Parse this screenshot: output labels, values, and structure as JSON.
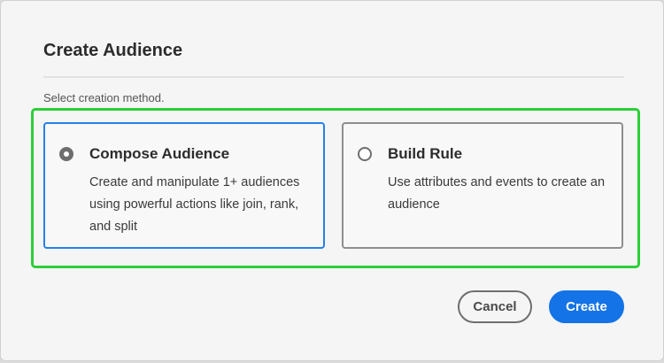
{
  "dialog": {
    "title": "Create Audience",
    "subtitle": "Select creation method."
  },
  "options": [
    {
      "title": "Compose Audience",
      "description": "Create and manipulate 1+ audiences using powerful actions like join, rank, and split",
      "selected": true
    },
    {
      "title": "Build Rule",
      "description": "Use attributes and events to create an audience",
      "selected": false
    }
  ],
  "actions": {
    "cancel_label": "Cancel",
    "create_label": "Create"
  },
  "colors": {
    "accent": "#1473e6",
    "selected_border": "#2680eb",
    "highlight": "#2ccf37"
  }
}
